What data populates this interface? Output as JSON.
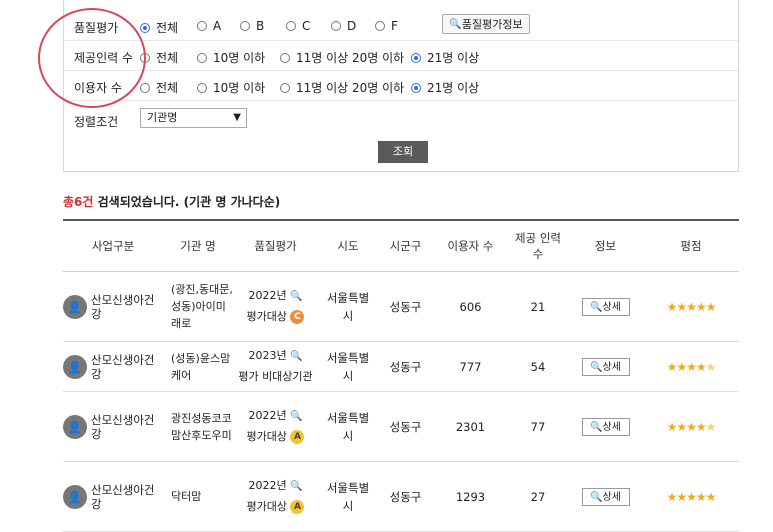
{
  "filters": {
    "grade": {
      "label": "품질평가",
      "options": [
        "전체",
        "A",
        "B",
        "C",
        "D",
        "F"
      ],
      "selected": "전체",
      "info_button": "품질평가정보"
    },
    "staff": {
      "label": "제공인력 수",
      "options": [
        "전체",
        "10명 이하",
        "11명 이상 20명 이하",
        "21명 이상"
      ],
      "selected": "21명 이상"
    },
    "users": {
      "label": "이용자 수",
      "options": [
        "전체",
        "10명 이하",
        "11명 이상 20명 이하",
        "21명 이상"
      ],
      "selected": "21명 이상"
    },
    "sort": {
      "label": "정렬조건",
      "value": "기관명"
    },
    "search_button": "조회"
  },
  "result": {
    "count": "총6건",
    "text": "검색되었습니다. (기관 명 가나다순)"
  },
  "table": {
    "headers": [
      "사업구분",
      "기관 명",
      "품질평가",
      "시도",
      "시군구",
      "이용자 수",
      "제공 인력 수",
      "정보",
      "평점"
    ],
    "rows": [
      {
        "biz": "산모신생아건강",
        "org": "(광진,동대문,성동)아이미래로",
        "year": "2022년",
        "grade_text": "평가대상",
        "grade_badge": "C",
        "sido": "서울특별시",
        "sigungu": "성동구",
        "users": "606",
        "staff": "21",
        "detail": "상세",
        "rating": 5
      },
      {
        "biz": "산모신생아건강",
        "org": "(성동)윤스맘케어",
        "year": "2023년",
        "grade_text": "평가 비대상기관",
        "grade_badge": "",
        "sido": "서울특별시",
        "sigungu": "성동구",
        "users": "777",
        "staff": "54",
        "detail": "상세",
        "rating": 4.5
      },
      {
        "biz": "산모신생아건강",
        "org": "광진성동코코맘산후도우미",
        "year": "2022년",
        "grade_text": "평가대상",
        "grade_badge": "A",
        "sido": "서울특별시",
        "sigungu": "성동구",
        "users": "2301",
        "staff": "77",
        "detail": "상세",
        "rating": 4.5
      },
      {
        "biz": "산모신생아건강",
        "org": "닥터맘",
        "year": "2022년",
        "grade_text": "평가대상",
        "grade_badge": "A",
        "sido": "서울특별시",
        "sigungu": "성동구",
        "users": "1293",
        "staff": "27",
        "detail": "상세",
        "rating": 5
      }
    ]
  },
  "colors": {
    "annotation_circle": "#d9485a",
    "radio_selected": "#2a6fd6",
    "result_count": "#d62d2d",
    "star": "#f2a91b"
  }
}
